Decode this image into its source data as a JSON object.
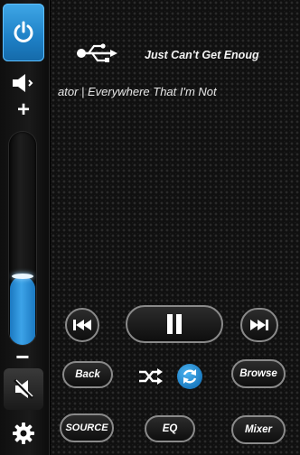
{
  "now_playing": {
    "title": "Just Can't Get Enoug",
    "artist_album": "ator | Everywhere That I'm Not",
    "source_icon": "usb-icon"
  },
  "volume": {
    "level_fraction": 0.32,
    "plus_label": "+",
    "minus_label": "−"
  },
  "transport": {
    "prev_icon": "previous-icon",
    "play_pause_icon": "pause-icon",
    "next_icon": "next-icon"
  },
  "controls": {
    "back_label": "Back",
    "browse_label": "Browse",
    "shuffle_icon": "shuffle-icon",
    "repeat_icon": "repeat-icon"
  },
  "bottom_bar": {
    "source_label": "SOURCE",
    "eq_label": "EQ",
    "mixer_label": "Mixer"
  },
  "colors": {
    "accent": "#2a8fd6",
    "background": "#101010",
    "button_border": "#8a8a8a"
  }
}
